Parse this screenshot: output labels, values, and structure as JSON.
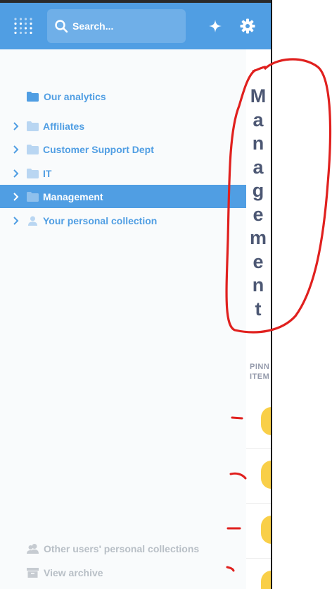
{
  "header": {
    "search_placeholder": "Search...",
    "logo_icon": "metabase-logo-icon",
    "new_icon": "sparkle-icon",
    "settings_icon": "gear-icon"
  },
  "sidebar": {
    "root": {
      "label": "Our analytics",
      "icon": "folder-icon"
    },
    "items": [
      {
        "label": "Affiliates",
        "icon": "folder-icon",
        "expandable": true,
        "active": false
      },
      {
        "label": "Customer Support Dept",
        "icon": "folder-icon",
        "expandable": true,
        "active": false
      },
      {
        "label": "IT",
        "icon": "folder-icon",
        "expandable": true,
        "active": false
      },
      {
        "label": "Management",
        "icon": "folder-icon",
        "expandable": true,
        "active": true
      },
      {
        "label": "Your personal collection",
        "icon": "person-icon",
        "expandable": true,
        "active": false
      }
    ],
    "footer": [
      {
        "label": "Other users' personal collections",
        "icon": "people-icon"
      },
      {
        "label": "View archive",
        "icon": "archive-icon"
      }
    ]
  },
  "main": {
    "title_letters": [
      "M",
      "a",
      "n",
      "a",
      "g",
      "e",
      "m",
      "e",
      "n",
      "t"
    ],
    "pinned_line1": "PINN",
    "pinned_line2": "ITEM"
  },
  "colors": {
    "brand": "#509ee3",
    "sidebar_bg": "#f9fbfc",
    "title_text": "#4c5773",
    "pin_yellow": "#f9cf48",
    "annotation_red": "#e0201e"
  }
}
